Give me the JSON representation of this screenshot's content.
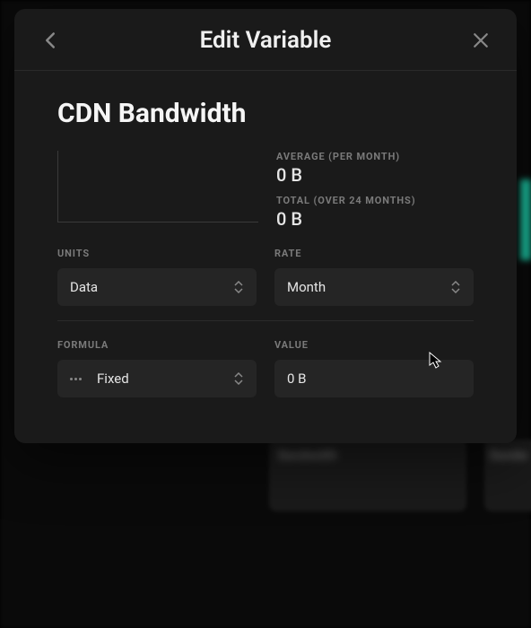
{
  "modal": {
    "title": "Edit Variable",
    "variable_name": "CDN Bandwidth",
    "stats": {
      "average": {
        "label": "AVERAGE (PER MONTH)",
        "value": "0 B"
      },
      "total": {
        "label": "TOTAL (OVER 24 MONTHS)",
        "value": "0 B"
      }
    },
    "fields": {
      "units": {
        "label": "UNITS",
        "value": "Data"
      },
      "rate": {
        "label": "RATE",
        "value": "Month"
      },
      "formula": {
        "label": "FORMULA",
        "value": "Fixed"
      },
      "value": {
        "label": "VALUE",
        "value": "0 B"
      }
    }
  },
  "background": {
    "card1_line1": "Bandwidth",
    "card2_line1": "Bandw"
  }
}
